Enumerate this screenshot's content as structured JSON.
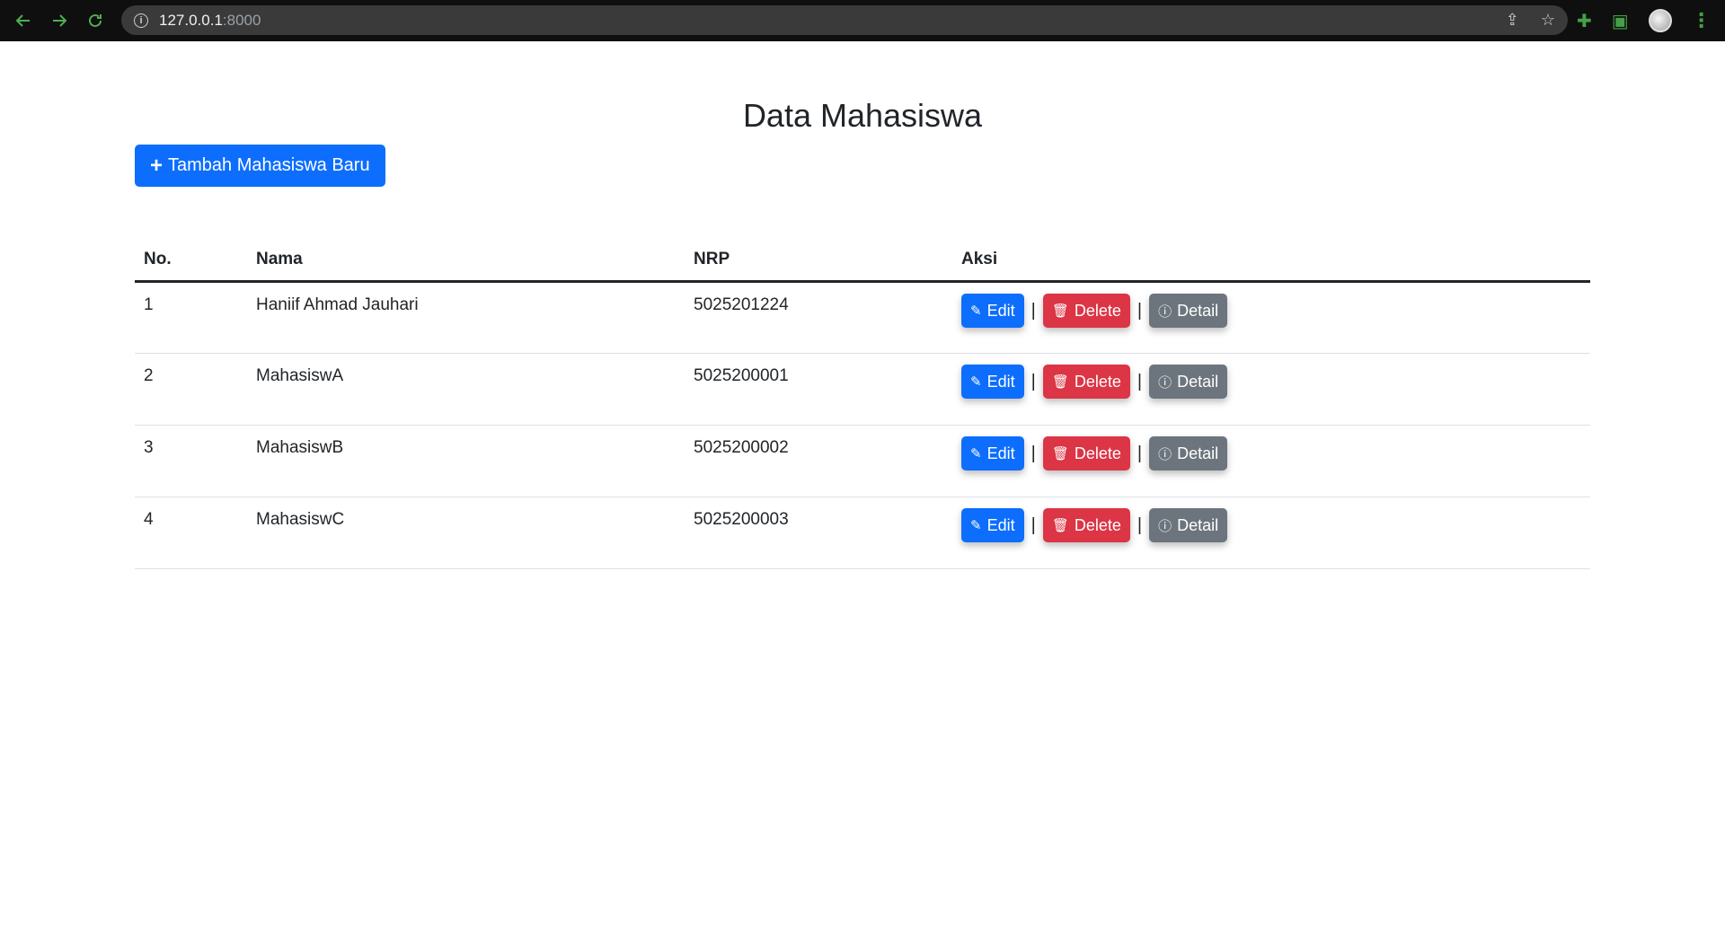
{
  "browser": {
    "url_host": "127.0.0.1",
    "url_port": ":8000"
  },
  "page": {
    "title": "Data Mahasiswa",
    "add_button_label": "Tambah Mahasiswa Baru"
  },
  "table": {
    "headers": [
      "No.",
      "Nama",
      "NRP",
      "Aksi"
    ],
    "rows": [
      {
        "no": "1",
        "nama": "Haniif Ahmad Jauhari",
        "nrp": "5025201224"
      },
      {
        "no": "2",
        "nama": "MahasiswA",
        "nrp": "5025200001"
      },
      {
        "no": "3",
        "nama": "MahasiswB",
        "nrp": "5025200002"
      },
      {
        "no": "4",
        "nama": "MahasiswC",
        "nrp": "5025200003"
      }
    ],
    "actions": {
      "edit": "Edit",
      "delete": "Delete",
      "detail": "Detail",
      "separator": "|"
    }
  },
  "colors": {
    "primary": "#0d6efd",
    "danger": "#dc3545",
    "secondary": "#6c757d"
  },
  "icons": {
    "back": "arrow-left-icon",
    "forward": "arrow-right-icon",
    "reload": "reload-icon",
    "site_info": "info-icon",
    "share": "share-icon",
    "bookmark": "star-icon",
    "extensions": "puzzle-icon",
    "sidebar": "side-panel-icon",
    "menu": "kebab-menu-icon",
    "add": "plus-icon",
    "edit": "edit-icon",
    "delete": "trash-icon",
    "detail": "info-circle-icon"
  }
}
